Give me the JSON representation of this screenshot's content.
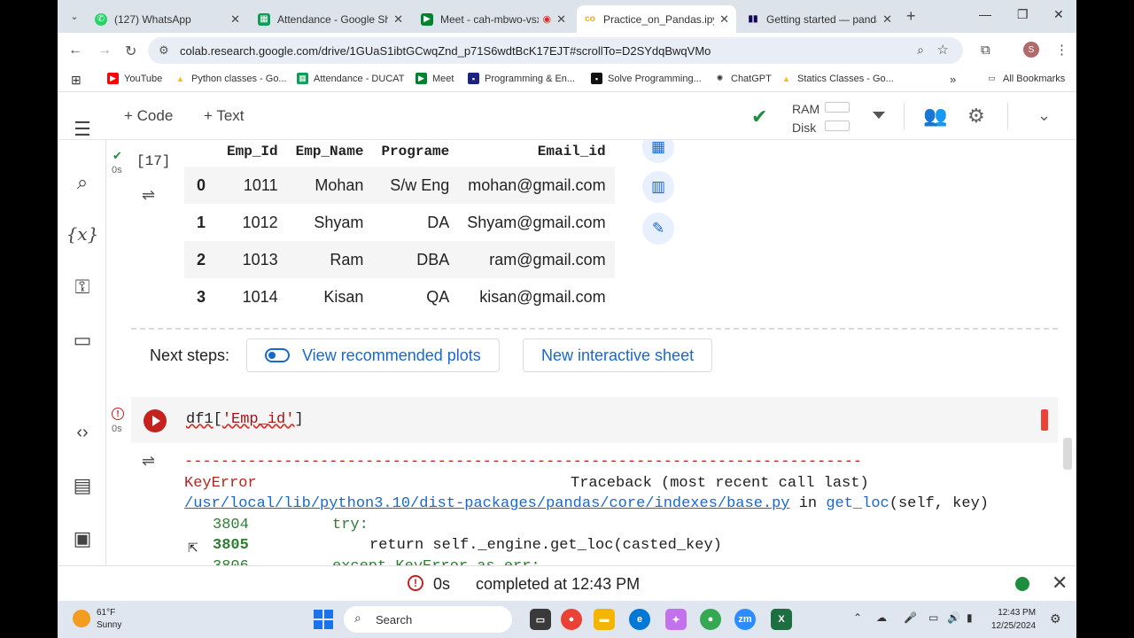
{
  "browser": {
    "tabs": [
      {
        "title": "(127) WhatsApp",
        "icon": "whatsapp-icon",
        "color": "#25d366"
      },
      {
        "title": "Attendance - Google Sheets",
        "icon": "sheets-icon",
        "color": "#0f9d58"
      },
      {
        "title": "Meet - cah-mbwo-vsx",
        "icon": "meet-icon",
        "color": "#00832d"
      },
      {
        "title": "Practice_on_Pandas.ipynb",
        "icon": "colab-icon",
        "color": "#f9ab00"
      },
      {
        "title": "Getting started — pandas",
        "icon": "pandas-icon",
        "color": "#150458"
      }
    ],
    "url": "colab.research.google.com/drive/1GUaS1ibtGCwqZnd_p71S6wdtBcK17EJT#scrollTo=D2SYdqBwqVMo",
    "profile_initial": "S",
    "bookmarks": [
      {
        "label": "YouTube",
        "icon": "youtube-icon",
        "color": "#ff0000"
      },
      {
        "label": "Python classes - Go...",
        "icon": "drive-icon",
        "color": "#fbbc04"
      },
      {
        "label": "Attendance - DUCAT",
        "icon": "sheets-icon",
        "color": "#0f9d58"
      },
      {
        "label": "Meet",
        "icon": "meet-icon",
        "color": "#00832d"
      },
      {
        "label": "Programming & En...",
        "icon": "page-icon",
        "color": "#1a237e"
      },
      {
        "label": "Solve Programming...",
        "icon": "page-icon",
        "color": "#111111"
      },
      {
        "label": "ChatGPT",
        "icon": "chatgpt-icon",
        "color": "#333333"
      },
      {
        "label": "Statics Classes - Go...",
        "icon": "drive-icon",
        "color": "#fbbc04"
      }
    ],
    "all_bookmarks": "All Bookmarks"
  },
  "colab": {
    "add_code": "+ Code",
    "add_text": "+ Text",
    "ram_label": "RAM",
    "disk_label": "Disk"
  },
  "cell1": {
    "exec_count": "[17]",
    "exec_time": "0s",
    "columns": [
      "",
      "Emp_Id",
      "Emp_Name",
      "Programe",
      "Email_id"
    ],
    "rows": [
      [
        "0",
        "1011",
        "Mohan",
        "S/w Eng",
        "mohan@gmail.com"
      ],
      [
        "1",
        "1012",
        "Shyam",
        "DA",
        "Shyam@gmail.com"
      ],
      [
        "2",
        "1013",
        "Ram",
        "DBA",
        "ram@gmail.com"
      ],
      [
        "3",
        "1014",
        "Kisan",
        "QA",
        "kisan@gmail.com"
      ]
    ],
    "next_steps_label": "Next steps:",
    "btn_plots": "View recommended plots",
    "btn_sheet": "New interactive sheet"
  },
  "cell2": {
    "exec_time": "0s",
    "code_fn": "df1",
    "code_open": "[",
    "code_str": "'Emp_id'",
    "code_close": "]",
    "dashes": "---------------------------------------------------------------------------",
    "err_name": "KeyError",
    "traceback_hdr": "Traceback (most recent call last)",
    "path": "/usr/local/lib/python3.10/dist-packages/pandas/core/indexes/base.py",
    "in": " in ",
    "fn": "get_loc",
    "args": "(self, key)",
    "l1_num": "3804",
    "l1_code": "try:",
    "l2_num": "3805",
    "l2_code": "return self._engine.get_loc(casted_key)",
    "l3_num": "3806",
    "l3_code": "except KeyError as err:"
  },
  "status": {
    "time": "0s",
    "completed": "completed at 12:43 PM"
  },
  "taskbar": {
    "temp": "61°F",
    "cond": "Sunny",
    "search": "Search",
    "time": "12:43 PM",
    "date": "12/25/2024"
  }
}
